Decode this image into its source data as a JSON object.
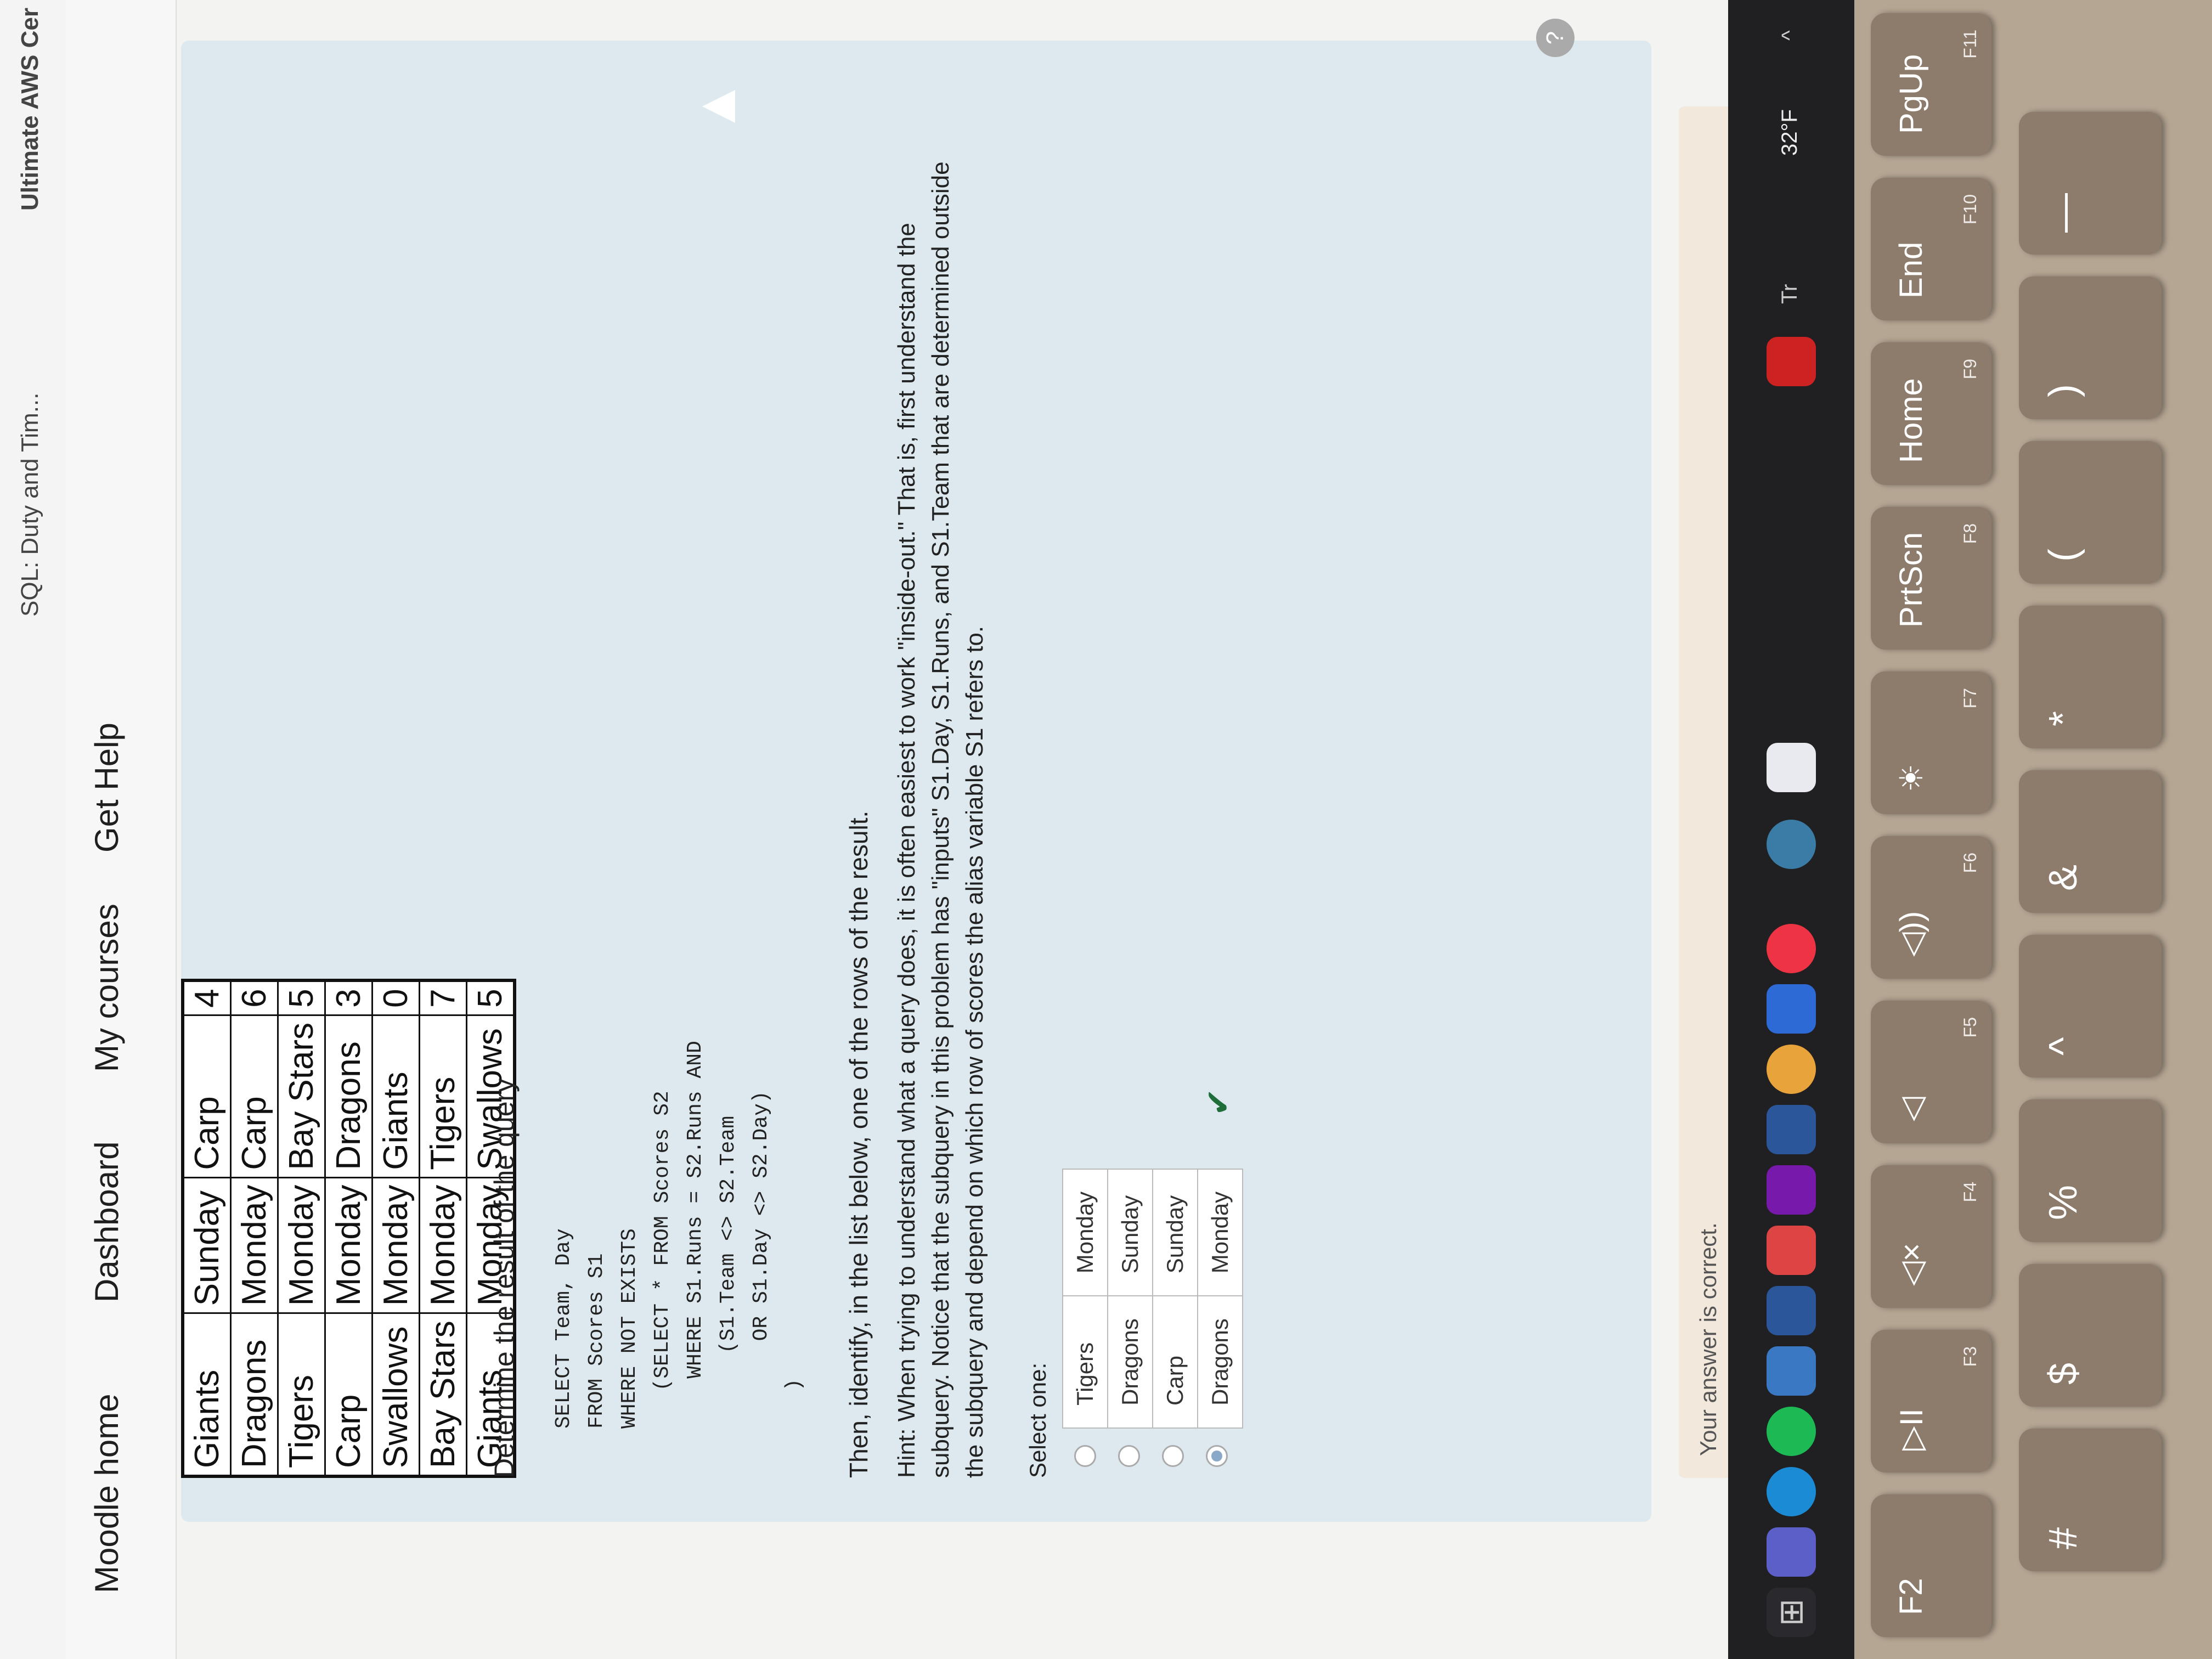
{
  "browser": {
    "tabs": [
      "SQL: Duty and Tim...",
      "Ultimate AWS Cer"
    ]
  },
  "nav": {
    "items": [
      "Moodle home",
      "Dashboard",
      "My courses",
      "Get Help"
    ]
  },
  "scores_table": {
    "rows": [
      [
        "Giants",
        "Sunday",
        "Carp",
        "4"
      ],
      [
        "Dragons",
        "Monday",
        "Carp",
        "6"
      ],
      [
        "Tigers",
        "Monday",
        "Bay Stars",
        "5"
      ],
      [
        "Carp",
        "Monday",
        "Dragons",
        "3"
      ],
      [
        "Swallows",
        "Monday",
        "Giants",
        "0"
      ],
      [
        "Bay Stars",
        "Monday",
        "Tigers",
        "7"
      ],
      [
        "Giants",
        "Monday",
        "Swallows",
        "5"
      ]
    ]
  },
  "question": {
    "intro": "Determine the result of the query",
    "sql": "SELECT Team, Day\nFROM Scores S1\nWHERE NOT EXISTS\n   (SELECT * FROM Scores S2\n    WHERE S1.Runs = S2.Runs AND\n      (S1.Team <> S2.Team\n       OR S1.Day <> S2.Day)\n   )",
    "then": "Then, identify, in the list below, one of the rows of the result.",
    "hint": "Hint: When trying to understand what a query does, it is often easiest to work \"inside-out.\" That is, first understand the subquery. Notice that the subquery in this problem has \"inputs\" S1.Day, S1.Runs, and S1.Team that are determined outside the subquery and depend on which row of scores the alias variable S1 refers to.",
    "select_label": "Select one:",
    "options": [
      {
        "team": "Tigers",
        "day": "Monday"
      },
      {
        "team": "Dragons",
        "day": "Sunday"
      },
      {
        "team": "Carp",
        "day": "Sunday"
      },
      {
        "team": "Dragons",
        "day": "Monday"
      }
    ],
    "selected_index": 3,
    "feedback": "Your answer is correct."
  },
  "help_button": "?",
  "taskbar": {
    "weather": "32°F",
    "tray_text": "Tr"
  },
  "keyboard": {
    "fn_row": [
      {
        "main": "F2",
        "fn": ""
      },
      {
        "main": "▷II",
        "fn": "F3"
      },
      {
        "main": "◁×",
        "fn": "F4"
      },
      {
        "main": "◁",
        "fn": "F5"
      },
      {
        "main": "◁))",
        "fn": "F6"
      },
      {
        "main": "☀",
        "fn": "F7"
      },
      {
        "main": "PrtScn",
        "fn": "F8"
      },
      {
        "main": "Home",
        "fn": "F9"
      },
      {
        "main": "End",
        "fn": "F10"
      },
      {
        "main": "PgUp",
        "fn": "F11"
      }
    ],
    "num_row": [
      "#",
      "$",
      "%",
      "^",
      "&",
      "*",
      "(",
      ")",
      "—"
    ]
  }
}
